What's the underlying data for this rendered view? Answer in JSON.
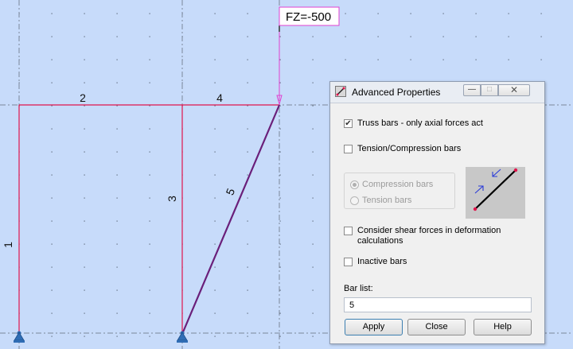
{
  "canvas": {
    "background": "#c7dbfa",
    "load_label": "FZ=-500",
    "bars": [
      {
        "label": "1",
        "color": "#e0144c"
      },
      {
        "label": "2",
        "color": "#e0144c"
      },
      {
        "label": "3",
        "color": "#e0144c"
      },
      {
        "label": "4",
        "color": "#e0144c"
      },
      {
        "label": "5",
        "color": "#6a1f7a"
      }
    ],
    "load_color": "#e040d0",
    "support_color": "#2f6db5"
  },
  "dialog": {
    "title": "Advanced Properties",
    "title_icon": "advanced-properties-icon",
    "window_buttons": {
      "minimize": "minimize-icon",
      "maximize": "maximize-icon",
      "close": "close-icon"
    },
    "checkboxes": [
      {
        "label": "Truss bars - only axial forces act",
        "checked": true
      },
      {
        "label": "Tension/Compression bars",
        "checked": false
      },
      {
        "label": "Consider shear forces in deformation calculations",
        "checked": false
      },
      {
        "label": "Inactive bars",
        "checked": false
      }
    ],
    "radios": [
      {
        "label": "Compression bars",
        "selected": true
      },
      {
        "label": "Tension bars",
        "selected": false
      }
    ],
    "bar_list": {
      "label": "Bar list:",
      "value": "5"
    },
    "buttons": {
      "apply": "Apply",
      "close": "Close",
      "help": "Help"
    }
  }
}
